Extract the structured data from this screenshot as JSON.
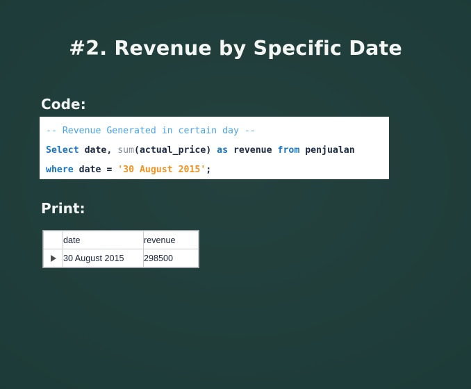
{
  "slide": {
    "title": "#2. Revenue by Specific Date",
    "background_color": "#1d3b38",
    "text_color": "#f4f6f4"
  },
  "sections": {
    "code_label": "Code:",
    "print_label": "Print:"
  },
  "code": {
    "language": "sql",
    "background_color": "#ffffff",
    "colors": {
      "comment": "#4aa3e8",
      "keyword": "#1874c8",
      "function": "#7f8c99",
      "string": "#f0921f",
      "plain": "#1b2a45"
    },
    "line1": {
      "comment": "-- Revenue Generated in certain day --"
    },
    "line2": {
      "kw_select": "Select",
      "col_date": " date, ",
      "fn_sum": "sum",
      "arg": "(actual_price) ",
      "kw_as": "as",
      "alias": " revenue ",
      "kw_from": "from",
      "table": " penjualan"
    },
    "line3": {
      "kw_where": "where",
      "col_date": " date ",
      "op": "= ",
      "string": "'30 August 2015'",
      "semicolon": ";"
    }
  },
  "result": {
    "columns": [
      "date",
      "revenue"
    ],
    "rows": [
      {
        "marker": "current-row-arrow",
        "date": "30 August 2015",
        "revenue": "298500"
      }
    ]
  }
}
